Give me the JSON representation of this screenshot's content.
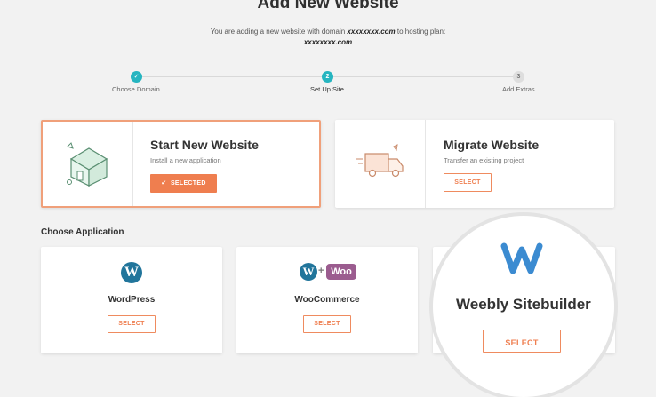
{
  "header": {
    "title": "Add New Website",
    "subtitle_prefix": "You are adding a new website with domain",
    "domain": "xxxxxxxx.com",
    "subtitle_suffix": "to hosting plan:",
    "plan": "xxxxxxxx.com"
  },
  "steps": [
    {
      "number": "✓",
      "label": "Choose Domain",
      "state": "done"
    },
    {
      "number": "2",
      "label": "Set Up Site",
      "state": "active"
    },
    {
      "number": "3",
      "label": "Add Extras",
      "state": "todo"
    }
  ],
  "options": {
    "start": {
      "title": "Start New Website",
      "subtitle": "Install a new application",
      "button": "SELECTED",
      "icon": "house-icon"
    },
    "migrate": {
      "title": "Migrate Website",
      "subtitle": "Transfer an existing project",
      "button": "SELECT",
      "icon": "truck-icon"
    }
  },
  "applications": {
    "section_label": "Choose Application",
    "items": [
      {
        "name": "WordPress",
        "button": "SELECT",
        "icon": "wordpress-icon"
      },
      {
        "name": "WooCommerce",
        "button": "SELECT",
        "icon": "woocommerce-icon",
        "badge": "Woo",
        "plus": "+"
      },
      {
        "name": "Weebly Sitebuilder",
        "button": "SELECT",
        "icon": "weebly-icon"
      }
    ]
  },
  "colors": {
    "accent": "#ef7e4f",
    "step_active": "#26b5c0",
    "wordpress": "#21759b",
    "woo": "#9b5c8f",
    "weebly": "#3b8bd1"
  }
}
